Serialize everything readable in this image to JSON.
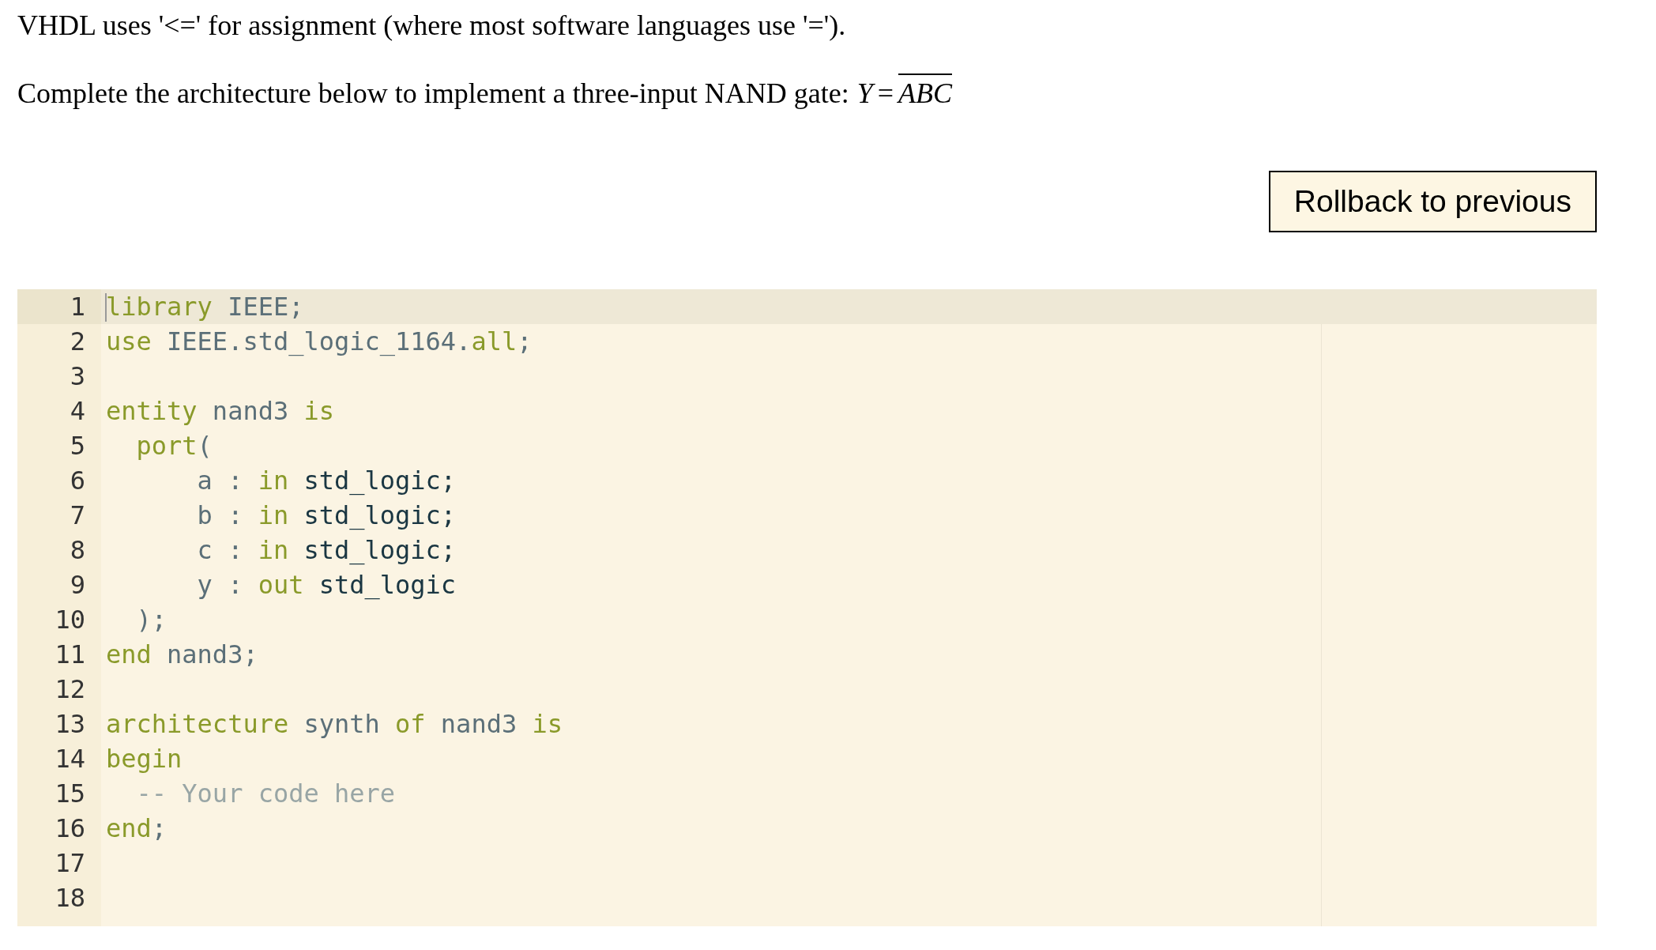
{
  "intro": "VHDL uses '<=' for assignment (where most software languages use '=').",
  "prompt": {
    "text": "Complete the architecture below to implement a three-input NAND gate:",
    "formula": {
      "lhs": "Y",
      "op": "=",
      "overlined": "ABC"
    }
  },
  "rollback_button": "Rollback to previous",
  "editor": {
    "lines": [
      {
        "number": "1",
        "active": true,
        "tokens": [
          {
            "kind": "keyword",
            "text": "library"
          },
          {
            "kind": "ident",
            "text": " IEEE;"
          }
        ]
      },
      {
        "number": "2",
        "active": false,
        "tokens": [
          {
            "kind": "keyword",
            "text": "use"
          },
          {
            "kind": "ident",
            "text": " IEEE.std_logic_1164."
          },
          {
            "kind": "keyword",
            "text": "all"
          },
          {
            "kind": "ident",
            "text": ";"
          }
        ]
      },
      {
        "number": "3",
        "active": false
      },
      {
        "number": "4",
        "active": false,
        "tokens": [
          {
            "kind": "keyword",
            "text": "entity"
          },
          {
            "kind": "ident",
            "text": " nand3 "
          },
          {
            "kind": "keyword",
            "text": "is"
          }
        ]
      },
      {
        "number": "5",
        "active": false,
        "tokens": [
          {
            "kind": "keyword",
            "text": "  port"
          },
          {
            "kind": "ident",
            "text": "("
          }
        ]
      },
      {
        "number": "6",
        "active": false,
        "tokens": [
          {
            "kind": "ident",
            "text": "      a : "
          },
          {
            "kind": "keyword",
            "text": "in"
          },
          {
            "kind": "type",
            "text": " std_logic;"
          }
        ]
      },
      {
        "number": "7",
        "active": false,
        "tokens": [
          {
            "kind": "ident",
            "text": "      b : "
          },
          {
            "kind": "keyword",
            "text": "in"
          },
          {
            "kind": "type",
            "text": " std_logic;"
          }
        ]
      },
      {
        "number": "8",
        "active": false,
        "tokens": [
          {
            "kind": "ident",
            "text": "      c : "
          },
          {
            "kind": "keyword",
            "text": "in"
          },
          {
            "kind": "type",
            "text": " std_logic;"
          }
        ]
      },
      {
        "number": "9",
        "active": false,
        "tokens": [
          {
            "kind": "ident",
            "text": "      y : "
          },
          {
            "kind": "keyword",
            "text": "out"
          },
          {
            "kind": "type",
            "text": " std_logic"
          }
        ]
      },
      {
        "number": "10",
        "active": false,
        "tokens": [
          {
            "kind": "ident",
            "text": "  );"
          }
        ]
      },
      {
        "number": "11",
        "active": false,
        "tokens": [
          {
            "kind": "keyword",
            "text": "end"
          },
          {
            "kind": "ident",
            "text": " nand3;"
          }
        ]
      },
      {
        "number": "12",
        "active": false
      },
      {
        "number": "13",
        "active": false,
        "tokens": [
          {
            "kind": "keyword",
            "text": "architecture"
          },
          {
            "kind": "ident",
            "text": " synth "
          },
          {
            "kind": "keyword",
            "text": "of"
          },
          {
            "kind": "ident",
            "text": " nand3 "
          },
          {
            "kind": "keyword",
            "text": "is"
          }
        ]
      },
      {
        "number": "14",
        "active": false,
        "tokens": [
          {
            "kind": "keyword",
            "text": "begin"
          }
        ]
      },
      {
        "number": "15",
        "active": false,
        "tokens": [
          {
            "kind": "comment",
            "text": "  -- Your code here"
          }
        ]
      },
      {
        "number": "16",
        "active": false,
        "tokens": [
          {
            "kind": "keyword",
            "text": "end"
          },
          {
            "kind": "ident",
            "text": ";"
          }
        ]
      },
      {
        "number": "17",
        "active": false
      },
      {
        "number": "18",
        "active": false
      }
    ]
  }
}
